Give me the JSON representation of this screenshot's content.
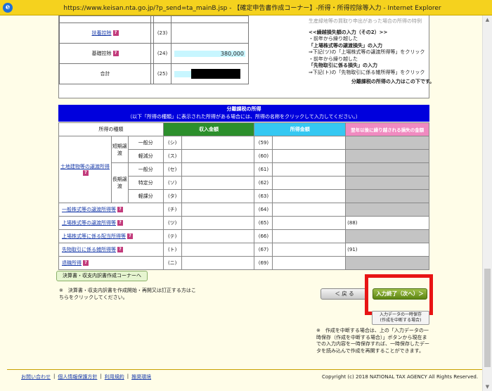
{
  "window": {
    "title": "https://www.keisan.nta.go.jp/?p_send=ta_mainB.jsp - 【確定申告書作成コーナー】-所得・所得控除等入力 - Internet Explorer",
    "icon": "ie-icon"
  },
  "deductions": [
    {
      "label": "扶養控除",
      "link": true,
      "num": "(23)",
      "value": ""
    },
    {
      "label": "基礎控除",
      "link": false,
      "num": "(24)",
      "value": "380,000"
    },
    {
      "label": "合計",
      "link": false,
      "num": "(25)",
      "value": ""
    }
  ],
  "notes": {
    "line0": "生産緑地等の買取り申出があった場合の所得の特例",
    "line1": "<<繰越損失額の入力（その2）>>",
    "line2": "・前年から繰り越した",
    "line3": "「上場株式等の譲渡損失」の入力",
    "line4": "⇒下記(ツ)の「上場株式等の譲渡所得等」をクリック",
    "line5": "・前年から繰り越した",
    "line6": "「先物取引に係る損失」の入力",
    "line7": "⇒下記(ト)の「先物取引に係る雑所得等」をクリック",
    "line8": "分離課税の所得の入力はこの下です。"
  },
  "separate": {
    "title": "分離課税の所得",
    "subtitle": "（以下「所得の種類」に表示された所得がある場合には、所得の名称をクリックして入力してください。）",
    "col_type": "所得の種類",
    "col_income": "収入金額",
    "col_amount": "所得金額",
    "col_loss": "翌年以後に繰り越される損失の金額",
    "land_label": "土地建物等の譲渡所得",
    "short_term": "短期譲渡",
    "long_term": "長期譲渡",
    "rows": [
      {
        "sub": "一般分",
        "code": "(シ)",
        "num": "(59)"
      },
      {
        "sub": "軽減分",
        "code": "(ス)",
        "num": "(60)"
      },
      {
        "sub": "一般分",
        "code": "(セ)",
        "num": "(61)"
      },
      {
        "sub": "特定分",
        "code": "(ソ)",
        "num": "(62)"
      },
      {
        "sub": "軽課分",
        "code": "(タ)",
        "num": "(63)"
      }
    ],
    "other_rows": [
      {
        "label": "一般株式等の譲渡所得等",
        "code": "(チ)",
        "num": "(64)",
        "loss": ""
      },
      {
        "label": "上場株式等の譲渡所得等",
        "code": "(ツ)",
        "num": "(65)",
        "loss": "(88)"
      },
      {
        "label": "上場株式等に係る配当所得等",
        "code": "(テ)",
        "num": "(66)",
        "loss": ""
      },
      {
        "label": "先物取引に係る雑所得等",
        "code": "(ト)",
        "num": "(67)",
        "loss": "(91)"
      },
      {
        "label": "退職所得",
        "code": "(ニ)",
        "num": "(69)",
        "loss": ""
      }
    ]
  },
  "buttons": {
    "corner": "決算書・収支内訳書作成コーナーへ",
    "back": "＜ 戻 る",
    "next": "入力終了（次へ）＞",
    "pause_line1": "入力データの一時保存",
    "pause_line2": "(作成を中断する場合)"
  },
  "note_corner": "※　決算書・収支内訳書を作成開始・再開又は訂正する方はこちらをクリックしてください。",
  "note_pause": "※　作成を中断する場合は、上の「入力データの一時保存（作成を中断する場合）」ボタンから現在までの入力内容を一時保存すれば、一時保存したデータを読み込んで作成を再開することができます。",
  "footer": {
    "links": [
      "お問い合わせ",
      "個人情報保護方針",
      "利用規約",
      "推奨環境"
    ],
    "separator": "|",
    "copyright": "Copyright (c) 2018 NATIONAL TAX AGENCY All Rights Reserved."
  },
  "colors": {
    "title_bar": "#f5d21e",
    "page_bg": "#fffde8",
    "blue_header": "#0000dd",
    "income_header": "#2c8f2c",
    "amount_header": "#35c8f2",
    "loss_header": "#f08ac0",
    "highlight": "#e81414"
  }
}
